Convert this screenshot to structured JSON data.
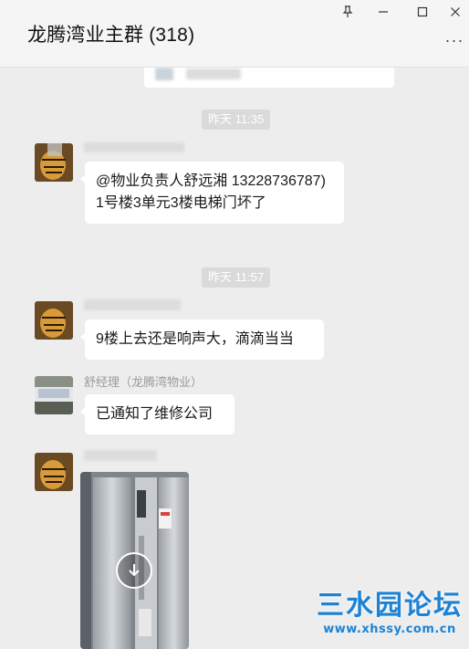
{
  "window": {
    "title": "龙腾湾业主群 (318)",
    "controls": {
      "pin": "⚲",
      "minimize": "—",
      "maximize": "☐",
      "close": "✕"
    },
    "more_label": "···"
  },
  "messages": [
    {
      "type": "timestamp",
      "text": "昨天 11:35"
    },
    {
      "type": "text",
      "sender_name": "",
      "text": "@物业负责人舒远湘 13228736787) 1号楼3单元3楼电梯门坏了"
    },
    {
      "type": "timestamp",
      "text": "昨天 11:57"
    },
    {
      "type": "text",
      "sender_name": "",
      "text": "9楼上去还是响声大，滴滴当当"
    },
    {
      "type": "text",
      "sender_name": "舒经理（龙腾湾物业）",
      "text": "已通知了维修公司"
    },
    {
      "type": "video",
      "sender_name": "",
      "icon": "download-icon"
    }
  ],
  "watermark": {
    "title": "三水园论坛",
    "url": "www.xhssy.com.cn"
  },
  "colors": {
    "background": "#ededed",
    "bubble": "#ffffff",
    "timestamp_bg": "#dadada",
    "watermark": "#1e82d4"
  }
}
